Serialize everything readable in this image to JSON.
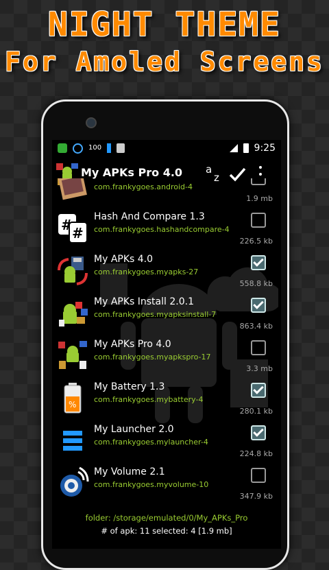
{
  "promo": {
    "line1": "NIGHT THEME",
    "line2": "For Amoled Screens"
  },
  "status_bar": {
    "time": "9:25",
    "notif_badge": "100"
  },
  "action_bar": {
    "title": "My APKs Pro 4.0",
    "sort_a": "a",
    "sort_z": "z"
  },
  "apps": [
    {
      "name": "",
      "package": "com.frankygoes.android-4",
      "size": "1.9 mb",
      "checked": false,
      "icon": "android-photo-icon"
    },
    {
      "name": "Hash And Compare 1.3",
      "package": "com.frankygoes.hashandcompare-4",
      "size": "226.5 kb",
      "checked": false,
      "icon": "hash-icon"
    },
    {
      "name": "My APKs 4.0",
      "package": "com.frankygoes.myapks-27",
      "size": "558.8 kb",
      "checked": true,
      "icon": "myapks-icon"
    },
    {
      "name": "My APKs Install 2.0.1",
      "package": "com.frankygoes.myapksinstall-7",
      "size": "863.4 kb",
      "checked": true,
      "icon": "myapks-install-icon"
    },
    {
      "name": "My APKs Pro 4.0",
      "package": "com.frankygoes.myapkspro-17",
      "size": "3.3 mb",
      "checked": false,
      "icon": "myapks-pro-icon"
    },
    {
      "name": "My Battery 1.3",
      "package": "com.frankygoes.mybattery-4",
      "size": "280.1 kb",
      "checked": true,
      "icon": "battery-icon"
    },
    {
      "name": "My Launcher 2.0",
      "package": "com.frankygoes.mylauncher-4",
      "size": "224.8 kb",
      "checked": true,
      "icon": "launcher-icon"
    },
    {
      "name": "My Volume 2.1",
      "package": "com.frankygoes.myvolume-10",
      "size": "347.9 kb",
      "checked": false,
      "icon": "volume-icon"
    }
  ],
  "footer": {
    "folder": "folder: /storage/emulated/0/My_APKs_Pro",
    "stats": "# of apk: 11   selected: 4 [1.9 mb]"
  },
  "colors": {
    "promo_orange": "#ff8a00",
    "package_green": "#9acd32",
    "screen_bg": "#000000"
  }
}
